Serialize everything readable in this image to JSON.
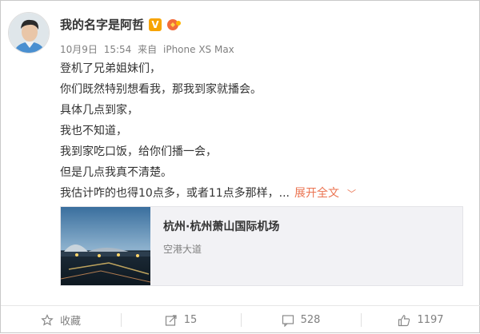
{
  "post": {
    "username": "我的名字是阿哲",
    "verified_badge": "V",
    "date": "10月9日",
    "time": "15:54",
    "source_prefix": "来自",
    "device": "iPhone XS Max",
    "lines": [
      "登机了兄弟姐妹们，",
      "你们既然特别想看我，那我到家就播会。",
      "具体几点到家，",
      "我也不知道，",
      "我到家吃口饭，给你们播一会，",
      "但是几点我真不清楚。",
      "我估计咋的也得10点多，或者11点多那样，..."
    ],
    "expand_label": "展开全文",
    "chevron": "﹀"
  },
  "location_card": {
    "title": "杭州·杭州萧山国际机场",
    "subtitle": "空港大道"
  },
  "actions": {
    "favorite_label": "收藏",
    "repost_count": "15",
    "comment_count": "528",
    "like_count": "1197"
  },
  "colors": {
    "accent": "#eb7350",
    "muted": "#808080",
    "card_bg": "#f2f2f5",
    "verified": "#f7a400"
  }
}
